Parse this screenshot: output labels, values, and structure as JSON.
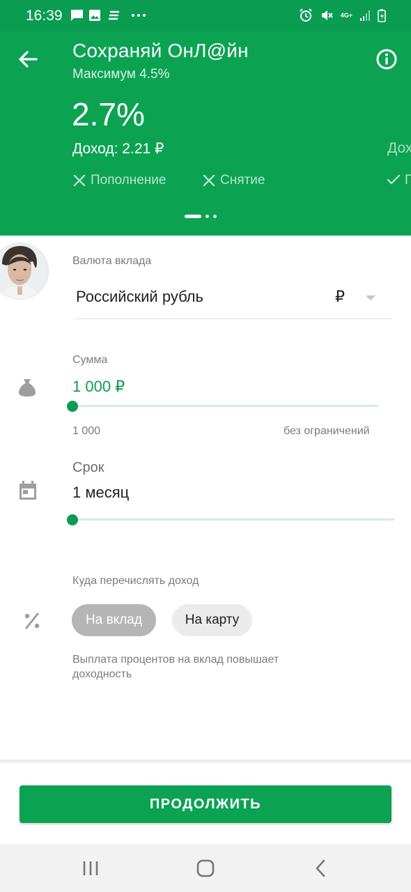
{
  "status_bar": {
    "time": "16:39",
    "network": "4G+",
    "icons": [
      "message-icon",
      "gallery-icon",
      "sberbank-icon",
      "more-icon",
      "alarm-icon",
      "mute-icon",
      "signal-icon",
      "battery-icon"
    ]
  },
  "header": {
    "title": "Сохраняй ОнЛ@йн",
    "subtitle": "Максимум 4.5%",
    "rate": "2.7%",
    "income": "Доход: 2.21 ₽",
    "income_next_peek": "Дох",
    "features": [
      {
        "label": "Пополнение",
        "available": false
      },
      {
        "label": "Снятие",
        "available": false
      }
    ],
    "carousel": {
      "count": 3,
      "active": 1
    },
    "colors": {
      "primary": "#0ba352",
      "status_bar": "#0a9d51"
    }
  },
  "currency": {
    "label": "Валюта вклада",
    "value": "Российский рубль",
    "symbol": "₽"
  },
  "amount": {
    "label": "Сумма",
    "value": "1 000 ₽",
    "min_label": "1 000",
    "max_label": "без ограничений",
    "slider_fraction": 0
  },
  "term": {
    "label": "Срок",
    "value": "1 месяц",
    "slider_fraction": 0
  },
  "payout": {
    "label": "Куда перечислять доход",
    "options": [
      {
        "label": "На вклад",
        "selected": true
      },
      {
        "label": "На карту",
        "selected": false
      }
    ],
    "note": "Выплата процентов на вклад повышает доходность"
  },
  "continue_button": {
    "label": "ПРОДОЛЖИТЬ"
  },
  "nav_bar": {
    "buttons": [
      "recent-apps",
      "home",
      "back"
    ]
  }
}
